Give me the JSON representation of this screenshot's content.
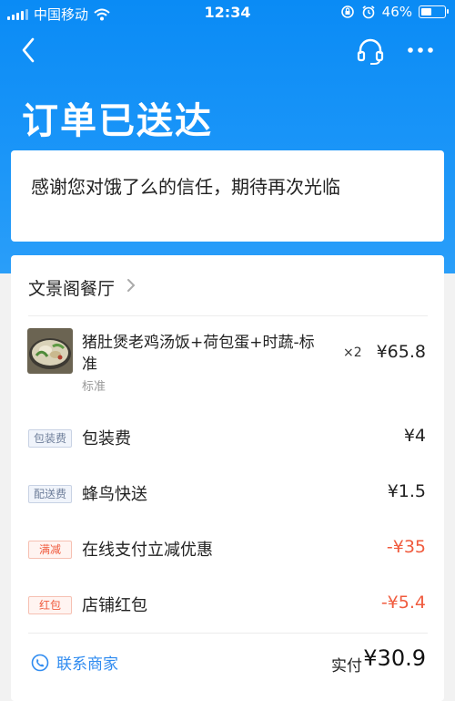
{
  "status_bar": {
    "carrier": "中国移动",
    "time": "12:34",
    "battery_percent": "46%",
    "battery_level": 0.46
  },
  "header": {
    "title": "订单已送达",
    "back_icon": "chevron-left-icon",
    "service_icon": "headset-icon",
    "more_icon": "more-dots-icon"
  },
  "thanks_message": "感谢您对饿了么的信任，期待再次光临",
  "order": {
    "shop_name": "文景阁餐厅",
    "item": {
      "name": "猪肚煲老鸡汤饭+荷包蛋+时蔬-标准",
      "spec": "标准",
      "quantity": "×2",
      "price": "¥65.8"
    },
    "fees": [
      {
        "tag": "包装费",
        "label": "包装费",
        "amount": "¥4",
        "tag_style": "blue",
        "amount_color": "#222222"
      },
      {
        "tag": "配送费",
        "label": "蜂鸟快送",
        "amount": "¥1.5",
        "tag_style": "blue",
        "amount_color": "#222222"
      },
      {
        "tag": "满减",
        "label": "在线支付立减优惠",
        "amount": "-¥35",
        "tag_style": "red",
        "amount_color": "#f05b3e"
      },
      {
        "tag": "红包",
        "label": "店铺红包",
        "amount": "-¥5.4",
        "tag_style": "red",
        "amount_color": "#f05b3e"
      }
    ],
    "contact_label": "联系商家",
    "paid_label": "实付",
    "paid_amount": "¥30.9"
  },
  "colors": {
    "brand_blue": "#0a8bf5",
    "link_blue": "#2f8bf0",
    "discount_red": "#f05b3e"
  }
}
